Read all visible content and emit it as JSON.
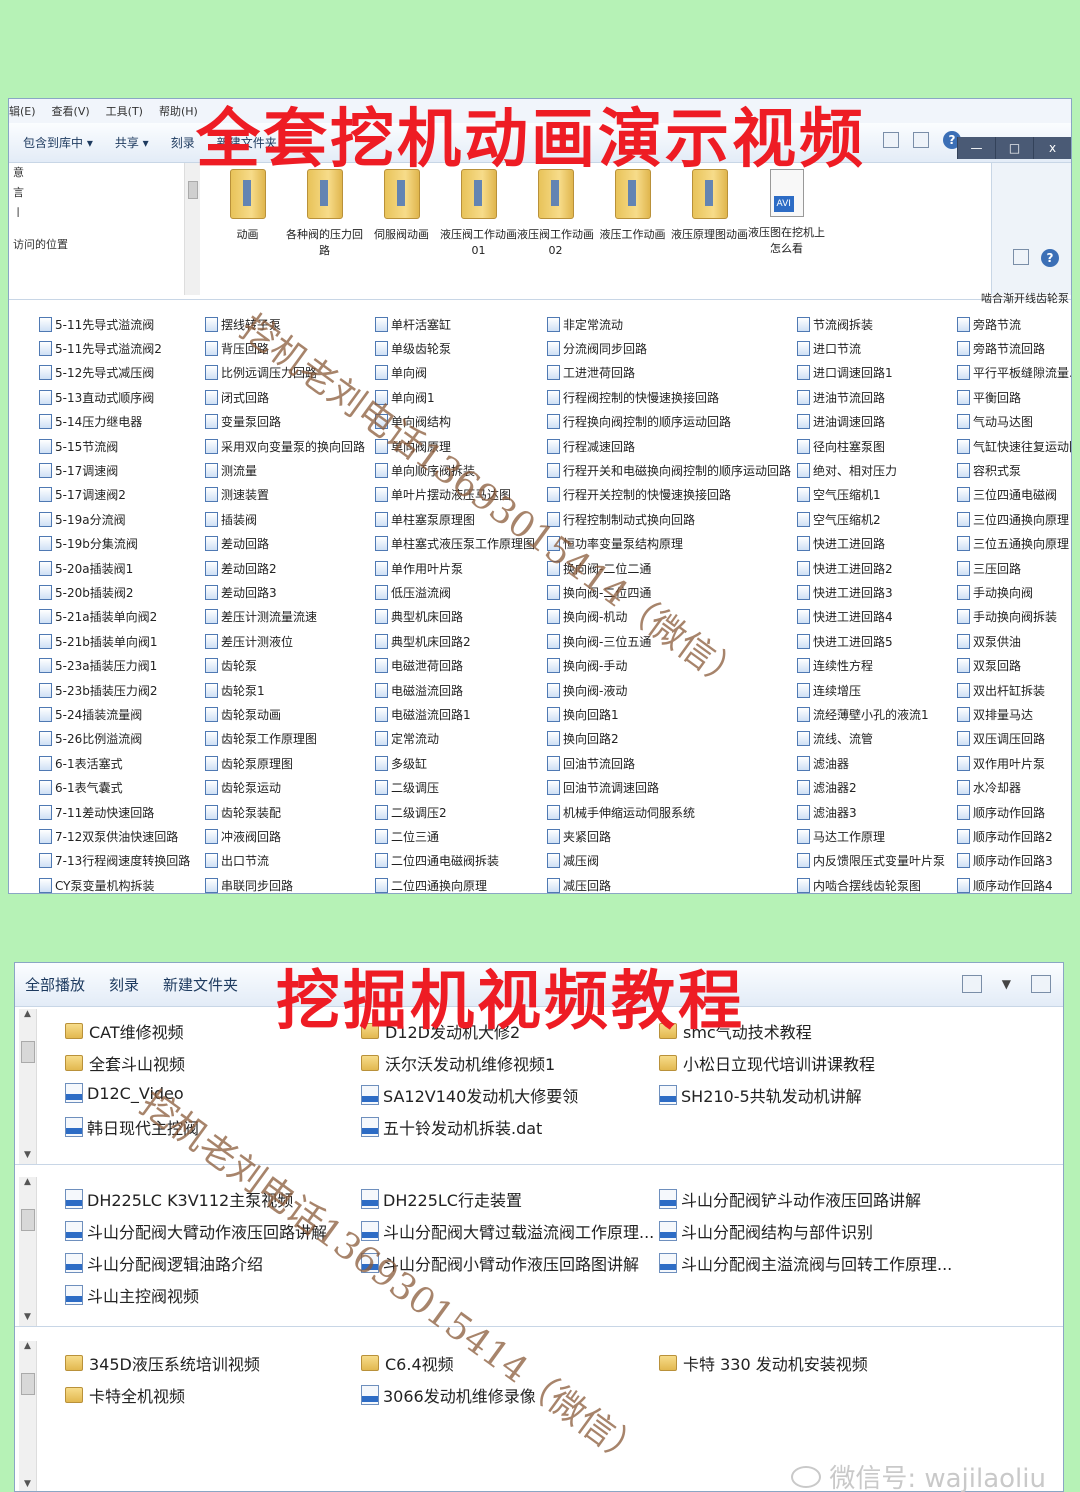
{
  "window1": {
    "menu": [
      "辑(E)",
      "查看(V)",
      "工具(T)",
      "帮助(H)"
    ],
    "toolbar": [
      "包含到库中 ▾",
      "共享 ▾",
      "刻录",
      "新建文件夹"
    ],
    "window_buttons": [
      "—",
      "□",
      "x"
    ],
    "left_nav": [
      "意",
      "言",
      "ㅣ",
      "访问的位置"
    ],
    "top_items": [
      {
        "label": "动画",
        "icon": "folder"
      },
      {
        "label": "各种阀的压力回路",
        "icon": "folder"
      },
      {
        "label": "伺服阀动画",
        "icon": "folder"
      },
      {
        "label": "液压阀工作动画01",
        "icon": "folder"
      },
      {
        "label": "液压阀工作动画02",
        "icon": "folder"
      },
      {
        "label": "液压工作动画",
        "icon": "folder"
      },
      {
        "label": "液压原理图动画",
        "icon": "folder"
      },
      {
        "label": "液压图在挖机上怎么看",
        "icon": "avi"
      }
    ],
    "columns": [
      [
        "5-11先导式溢流阀",
        "5-11先导式溢流阀2",
        "5-12先导式减压阀",
        "5-13直动式顺序阀",
        "5-14压力继电器",
        "5-15节流阀",
        "5-17调速阀",
        "5-17调速阀2",
        "5-19a分流阀",
        "5-19b分集流阀",
        "5-20a插装阀1",
        "5-20b插装阀2",
        "5-21a插装单向阀2",
        "5-21b插装单向阀1",
        "5-23a插装压力阀1",
        "5-23b插装压力阀2",
        "5-24插装流量阀",
        "5-26比例溢流阀",
        "6-1表活塞式",
        "6-1表气囊式",
        "7-11差动快速回路",
        "7-12双泵供油快速回路",
        "7-13行程阀速度转换回路",
        "CY泵变量机构拆装"
      ],
      [
        "摆线转子泵",
        "背压回路",
        "比例远调压力回路",
        "闭式回路",
        "变量泵回路",
        "采用双向变量泵的换向回路",
        "测流量",
        "测速装置",
        "插装阀",
        "差动回路",
        "差动回路2",
        "差动回路3",
        "差压计测流量流速",
        "差压计测液位",
        "齿轮泵",
        "齿轮泵1",
        "齿轮泵动画",
        "齿轮泵工作原理图",
        "齿轮泵原理图",
        "齿轮泵运动",
        "齿轮泵装配",
        "冲液阀回路",
        "出口节流",
        "串联同步回路"
      ],
      [
        "单杆活塞缸",
        "单级齿轮泵",
        "单向阀",
        "单向阀1",
        "单向阀结构",
        "单向阀原理",
        "单向顺序阀拆装",
        "单叶片摆动液压马达图",
        "单柱塞泵原理图",
        "单柱塞式液压泵工作原理图",
        "单作用叶片泵",
        "低压溢流阀",
        "典型机床回路",
        "典型机床回路2",
        "电磁泄荷回路",
        "电磁溢流回路",
        "电磁溢流回路1",
        "定常流动",
        "多级缸",
        "二级调压",
        "二级调压2",
        "二位三通",
        "二位四通电磁阀拆装",
        "二位四通换向原理"
      ],
      [
        "非定常流动",
        "分流阀同步回路",
        "工进泄荷回路",
        "行程阀控制的快慢速换接回路",
        "行程换向阀控制的顺序运动回路",
        "行程减速回路",
        "行程开关和电磁换向阀控制的顺序运动回路",
        "行程开关控制的快慢速换接回路",
        "行程控制制动式换向回路",
        "恒功率变量泵结构原理",
        "换向阀-二位二通",
        "换向阀-二位四通",
        "换向阀-机动",
        "换向阀-三位五通",
        "换向阀-手动",
        "换向阀-液动",
        "换向回路1",
        "换向回路2",
        "回油节流回路",
        "回油节流调速回路",
        "机械手伸缩运动伺服系统",
        "夹紧回路",
        "减压阀",
        "减压回路"
      ],
      [
        "节流阀拆装",
        "进口节流",
        "进口调速回路1",
        "进油节流回路",
        "进油调速回路",
        "径向柱塞泵图",
        "绝对、相对压力",
        "空气压缩机1",
        "空气压缩机2",
        "快进工进回路",
        "快进工进回路2",
        "快进工进回路3",
        "快进工进回路4",
        "快进工进回路5",
        "连续性方程",
        "连续增压",
        "流经薄壁小孔的液流1",
        "流线、流管",
        "滤油器",
        "滤油器2",
        "滤油器3",
        "马达工作原理",
        "内反馈限压式变量叶片泵",
        "内啮合摆线齿轮泵图"
      ],
      [
        "旁路节流",
        "旁路节流回路",
        "平行平板缝隙流量.f",
        "平衡回路",
        "气动马达图",
        "气缸快速往复运动回",
        "容积式泵",
        "三位四通电磁阀",
        "三位四通换向原理",
        "三位五通换向原理",
        "三压回路",
        "手动换向阀",
        "手动换向阀拆装",
        "双泵供油",
        "双泵回路",
        "双出杆缸拆装",
        "双排量马达",
        "双压调压回路",
        "双作用叶片泵",
        "水冷却器",
        "顺序动作回路",
        "顺序动作回路2",
        "顺序动作回路3",
        "顺序动作回路4"
      ]
    ],
    "col6_header": "啮合渐开线齿轮泵"
  },
  "window2": {
    "toolbar": [
      "全部播放",
      "刻录",
      "新建文件夹"
    ],
    "sections": [
      {
        "items": [
          {
            "label": "CAT维修视频",
            "icon": "folder"
          },
          {
            "label": "D12D发动机大修2",
            "icon": "folder"
          },
          {
            "label": "smc气动技术教程",
            "icon": "folder"
          },
          {
            "label": "全套斗山视频",
            "icon": "folder"
          },
          {
            "label": "沃尔沃发动机维修视频1",
            "icon": "folder"
          },
          {
            "label": "小松日立现代培训讲课教程",
            "icon": "folder"
          },
          {
            "label": "D12C_Video",
            "icon": "file"
          },
          {
            "label": "SA12V140发动机大修要领",
            "icon": "file"
          },
          {
            "label": "SH210-5共轨发动机讲解",
            "icon": "file"
          },
          {
            "label": "韩日现代主控阀",
            "icon": "file"
          },
          {
            "label": "五十铃发动机拆装.dat",
            "icon": "file"
          }
        ]
      },
      {
        "items": [
          {
            "label": "DH225LC K3V112主泵视频",
            "icon": "file"
          },
          {
            "label": "DH225LC行走装置",
            "icon": "file"
          },
          {
            "label": "斗山分配阀铲斗动作液压回路讲解",
            "icon": "file"
          },
          {
            "label": "斗山分配阀大臂动作液压回路讲解",
            "icon": "file"
          },
          {
            "label": "斗山分配阀大臂过载溢流阀工作原理...",
            "icon": "file"
          },
          {
            "label": "斗山分配阀结构与部件识别",
            "icon": "file"
          },
          {
            "label": "斗山分配阀逻辑油路介绍",
            "icon": "file"
          },
          {
            "label": "斗山分配阀小臂动作液压回路图讲解",
            "icon": "file"
          },
          {
            "label": "斗山分配阀主溢流阀与回转工作原理...",
            "icon": "file"
          },
          {
            "label": "斗山主控阀视频",
            "icon": "file"
          }
        ]
      },
      {
        "items": [
          {
            "label": "345D液压系统培训视频",
            "icon": "folder"
          },
          {
            "label": "C6.4视频",
            "icon": "folder"
          },
          {
            "label": "卡特 330 发动机安装视频",
            "icon": "folder"
          },
          {
            "label": "卡特全机视频",
            "icon": "folder"
          },
          {
            "label": "3066发动机维修录像",
            "icon": "file"
          }
        ]
      }
    ]
  },
  "overlay": {
    "title1": "全套挖机动画演示视频",
    "title2": "挖掘机视频教程",
    "watermark": "挖机老刘电话13693015414（微信）",
    "wechat_id": "微信号: wajilaoliu"
  }
}
